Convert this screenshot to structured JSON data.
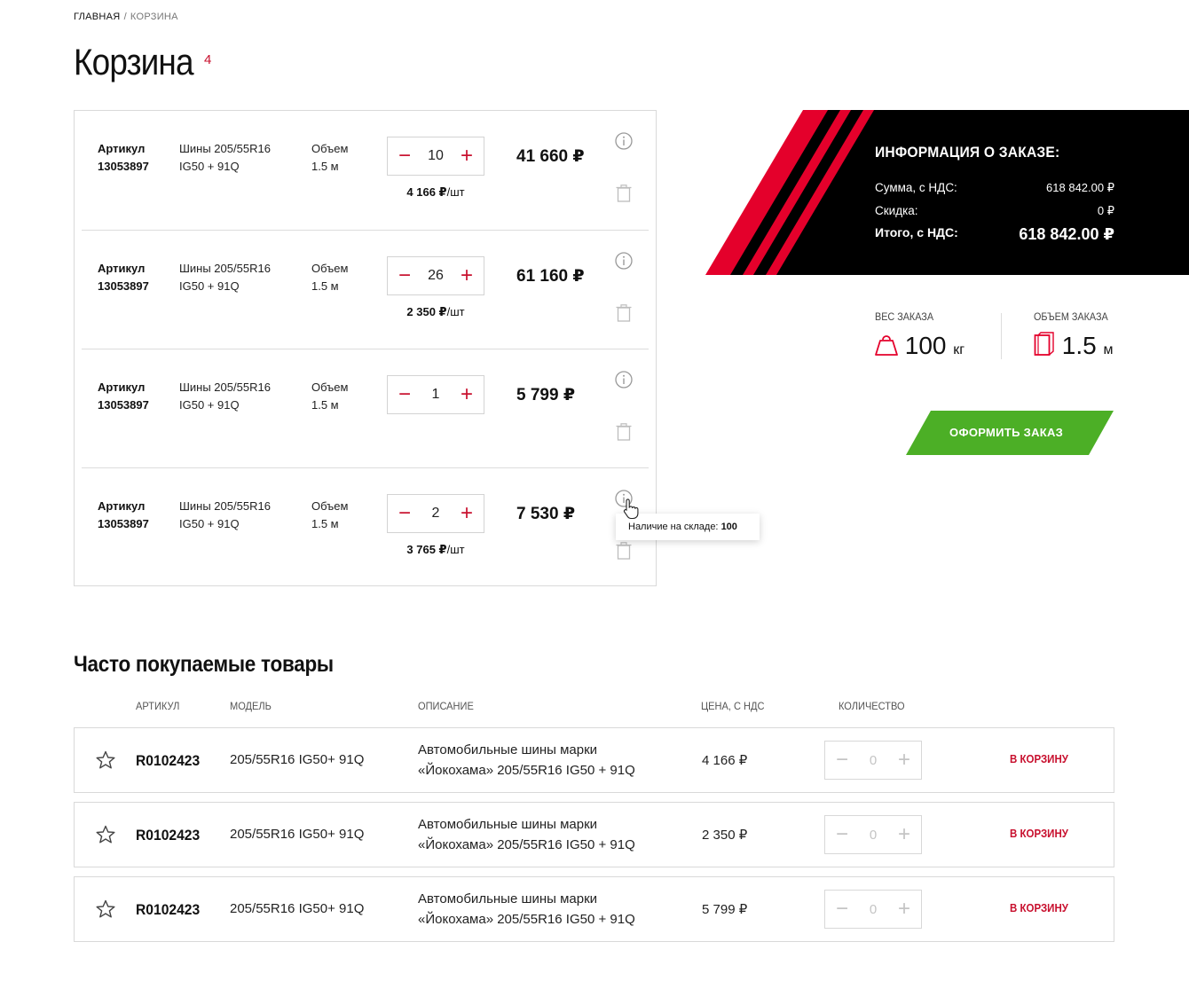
{
  "breadcrumb": {
    "home": "ГЛАВНАЯ",
    "separator": "/",
    "current": "КОРЗИНА"
  },
  "page": {
    "title": "Корзина",
    "count": "4"
  },
  "cart": {
    "items": [
      {
        "article_label": "Артикул",
        "article": "13053897",
        "name_line1": "Шины 205/55R16",
        "name_line2": "IG50 + 91Q",
        "volume_label": "Объем",
        "volume": "1.5 м",
        "qty": "10",
        "unit_price": "4 166 ₽",
        "unit_suffix": "/шт",
        "total": "41 660 ₽"
      },
      {
        "article_label": "Артикул",
        "article": "13053897",
        "name_line1": "Шины 205/55R16",
        "name_line2": "IG50 + 91Q",
        "volume_label": "Объем",
        "volume": "1.5 м",
        "qty": "26",
        "unit_price": "2 350 ₽",
        "unit_suffix": "/шт",
        "total": "61 160 ₽"
      },
      {
        "article_label": "Артикул",
        "article": "13053897",
        "name_line1": "Шины 205/55R16",
        "name_line2": "IG50 + 91Q",
        "volume_label": "Объем",
        "volume": "1.5 м",
        "qty": "1",
        "unit_price": "",
        "unit_suffix": "",
        "total": "5 799 ₽"
      },
      {
        "article_label": "Артикул",
        "article": "13053897",
        "name_line1": "Шины 205/55R16",
        "name_line2": "IG50 + 91Q",
        "volume_label": "Объем",
        "volume": "1.5 м",
        "qty": "2",
        "unit_price": "3 765 ₽",
        "unit_suffix": "/шт",
        "total": "7 530 ₽"
      }
    ],
    "tooltip": {
      "label": "Наличие на складе:",
      "value": "100"
    }
  },
  "order": {
    "title": "ИНФОРМАЦИЯ О ЗАКАЗЕ:",
    "sum_label": "Сумма, с НДС:",
    "sum_value": "618 842.00 ₽",
    "discount_label": "Скидка:",
    "discount_value": "0 ₽",
    "total_label": "Итого, с НДС:",
    "total_value": "618 842.00 ₽",
    "weight_label": "ВЕС ЗАКАЗА",
    "weight_value": "100",
    "weight_unit": "кг",
    "volume_label": "ОБЪЕМ ЗАКАЗА",
    "volume_value": "1.5",
    "volume_unit": "м",
    "checkout_label": "ОФОРМИТЬ ЗАКАЗ",
    "colors": {
      "panel": "#000000",
      "stripe": "#e4002b",
      "checkout": "#4caf26"
    }
  },
  "popular": {
    "title": "Часто покупаемые товары",
    "headers": {
      "article": "АРТИКУЛ",
      "model": "МОДЕЛЬ",
      "description": "ОПИСАНИЕ",
      "price": "ЦЕНА, С НДС",
      "qty": "КОЛИЧЕСТВО"
    },
    "items": [
      {
        "article": "R0102423",
        "model": "205/55R16 IG50+ 91Q",
        "desc_line1": "Автомобильные шины марки",
        "desc_line2": "«Йокохама» 205/55R16 IG50 + 91Q",
        "price": "4 166 ₽",
        "qty": "0",
        "add_label": "В КОРЗИНУ"
      },
      {
        "article": "R0102423",
        "model": "205/55R16 IG50+ 91Q",
        "desc_line1": "Автомобильные шины марки",
        "desc_line2": "«Йокохама» 205/55R16 IG50 + 91Q",
        "price": "2 350 ₽",
        "qty": "0",
        "add_label": "В КОРЗИНУ"
      },
      {
        "article": "R0102423",
        "model": "205/55R16 IG50+ 91Q",
        "desc_line1": "Автомобильные шины марки",
        "desc_line2": "«Йокохама» 205/55R16 IG50 + 91Q",
        "price": "5 799 ₽",
        "qty": "0",
        "add_label": "В КОРЗИНУ"
      }
    ]
  },
  "icons": [
    "info-icon",
    "trash-icon",
    "pointer-cursor-icon",
    "bag-weight-icon",
    "box-volume-icon",
    "chevron-right-icon",
    "star-icon",
    "minus-icon",
    "plus-icon"
  ]
}
